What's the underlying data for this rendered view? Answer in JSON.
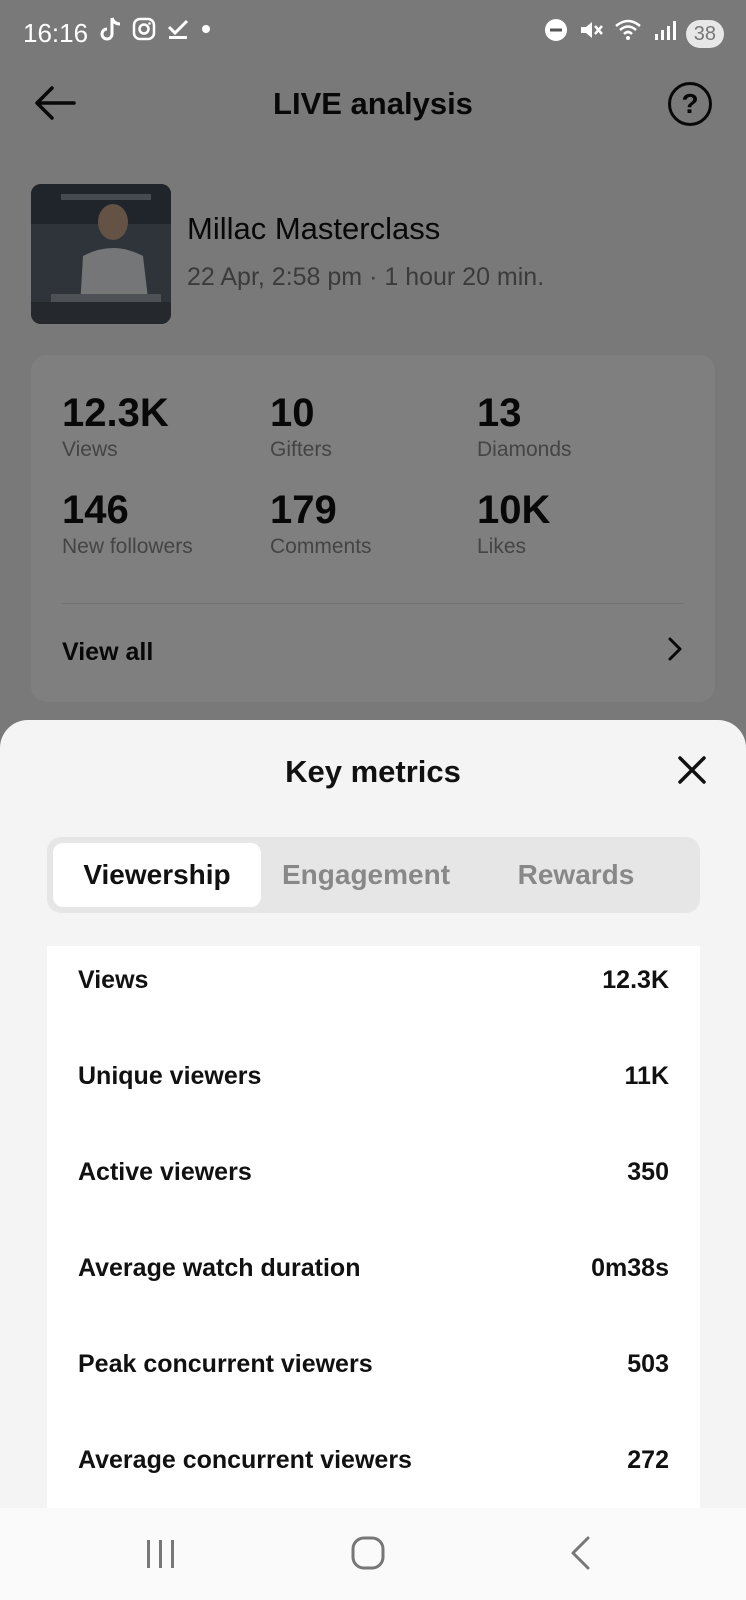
{
  "status_bar": {
    "time": "16:16",
    "battery": "38",
    "left_icons": [
      "tiktok-icon",
      "instagram-icon",
      "check-icon",
      "dot-icon"
    ],
    "right_icons": [
      "dnd-icon",
      "mute-icon",
      "wifi-icon",
      "signal-icon"
    ]
  },
  "header": {
    "title": "LIVE analysis"
  },
  "live": {
    "title": "Millac Masterclass",
    "meta": "22 Apr, 2:58 pm · 1 hour 20 min."
  },
  "stats": [
    {
      "value": "12.3K",
      "label": "Views"
    },
    {
      "value": "10",
      "label": "Gifters"
    },
    {
      "value": "13",
      "label": "Diamonds"
    },
    {
      "value": "146",
      "label": "New followers"
    },
    {
      "value": "179",
      "label": "Comments"
    },
    {
      "value": "10K",
      "label": "Likes"
    }
  ],
  "view_all_label": "View all",
  "sheet": {
    "title": "Key metrics",
    "tabs": [
      {
        "label": "Viewership",
        "active": true
      },
      {
        "label": "Engagement",
        "active": false
      },
      {
        "label": "Rewards",
        "active": false
      }
    ],
    "metrics": [
      {
        "label": "Views",
        "value": "12.3K"
      },
      {
        "label": "Unique viewers",
        "value": "11K"
      },
      {
        "label": "Active viewers",
        "value": "350"
      },
      {
        "label": "Average watch duration",
        "value": "0m38s"
      },
      {
        "label": "Peak concurrent viewers",
        "value": "503"
      },
      {
        "label": "Average concurrent viewers",
        "value": "272"
      }
    ]
  },
  "colors": {
    "overlay": "#000000",
    "active_tab_bg": "#ffffff",
    "inactive_tab_text": "#888888",
    "text_primary": "#111111",
    "text_secondary": "#888888"
  }
}
